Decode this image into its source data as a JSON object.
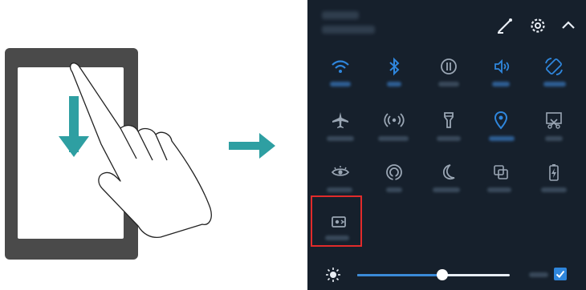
{
  "icons": {
    "left_illustration": [
      "tablet-device",
      "swipe-down-arrow",
      "hand-gesture"
    ],
    "transition": "right-arrow",
    "top_bar": [
      "edit-icon",
      "settings-icon",
      "collapse-chevron-icon"
    ],
    "tiles": [
      [
        "wifi-icon",
        "bluetooth-icon",
        "mobile-data-icon",
        "sound-icon",
        "auto-rotate-icon"
      ],
      [
        "airplane-mode-icon",
        "hotspot-icon",
        "flashlight-icon",
        "location-icon",
        "screenshot-icon"
      ],
      [
        "eye-comfort-icon",
        "nfc-icon",
        "do-not-disturb-icon",
        "huawei-share-icon",
        "battery-saver-icon"
      ],
      [
        "screen-recorder-icon"
      ]
    ],
    "bottom_bar": [
      "brightness-icon",
      "auto-brightness-checkbox"
    ]
  },
  "colors": {
    "panel_bg": "#16202c",
    "active_tile": "#2f86dc",
    "inactive_tile": "#9aa6b4",
    "highlight_border": "#e22b2b",
    "gesture_teal": "#2e9fa2"
  },
  "brightness": {
    "level": 0.56,
    "auto": true
  }
}
